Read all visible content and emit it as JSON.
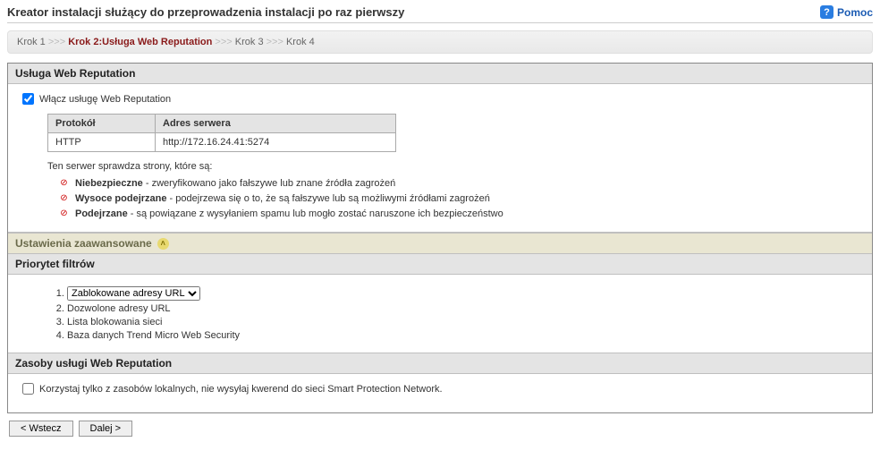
{
  "header": {
    "title": "Kreator instalacji służący do przeprowadzenia instalacji po raz pierwszy",
    "help": "Pomoc"
  },
  "breadcrumb": {
    "step1": "Krok 1",
    "step2": "Krok 2:Usługa Web Reputation",
    "step3": "Krok 3",
    "step4": "Krok 4",
    "sep": ">>>"
  },
  "web_reputation": {
    "section_title": "Usługa Web Reputation",
    "enable_label": "Włącz usługę Web Reputation",
    "enable_checked": true,
    "table": {
      "col_protocol": "Protokół",
      "col_address": "Adres serwera",
      "protocol": "HTTP",
      "address": "http://172.16.24.41:5274"
    },
    "desc": "Ten serwer sprawdza strony, które są:",
    "bullets": {
      "b1_title": "Niebezpieczne",
      "b1_rest": " - zweryfikowano jako fałszywe lub znane źródła zagrożeń",
      "b2_title": "Wysoce podejrzane",
      "b2_rest": " - podejrzewa się o to, że są fałszywe lub są możliwymi źródłami zagrożeń",
      "b3_title": "Podejrzane",
      "b3_rest": " - są powiązane z wysyłaniem spamu lub mogło zostać naruszone ich bezpieczeństwo"
    }
  },
  "advanced": {
    "title": "Ustawienia zaawansowane"
  },
  "priority": {
    "section_title": "Priorytet filtrów",
    "items": {
      "i1_selected": "Zablokowane adresy URL",
      "i2": "Dozwolone adresy URL",
      "i3": "Lista blokowania sieci",
      "i4": "Baza danych Trend Micro Web Security"
    }
  },
  "resources": {
    "section_title": "Zasoby usługi Web Reputation",
    "local_only_label": "Korzystaj tylko z zasobów lokalnych, nie wysyłaj kwerend do sieci Smart Protection Network.",
    "local_only_checked": false
  },
  "buttons": {
    "back": "< Wstecz",
    "next": "Dalej >"
  }
}
